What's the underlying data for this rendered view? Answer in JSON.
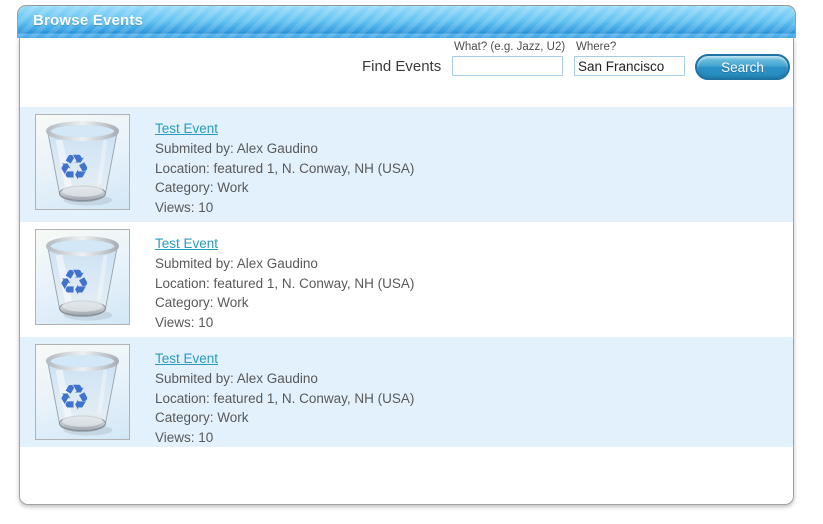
{
  "panel": {
    "title": "Browse Events"
  },
  "search": {
    "find_events_label": "Find Events",
    "what_label": "What? (e.g. Jazz, U2)",
    "what_value": "",
    "where_label": "Where?",
    "where_value": "San Francisco",
    "search_button_label": "Search"
  },
  "events": [
    {
      "title": "Test Event",
      "submitted_by": "Submited by: Alex Gaudino",
      "location": "Location: featured 1, N. Conway, NH (USA)",
      "category": "Category: Work",
      "views": "Views: 10",
      "thumbnail_icon": "recycle-bin-icon"
    },
    {
      "title": "Test Event",
      "submitted_by": "Submited by: Alex Gaudino",
      "location": "Location: featured 1, N. Conway, NH (USA)",
      "category": "Category: Work",
      "views": "Views: 10",
      "thumbnail_icon": "recycle-bin-icon"
    },
    {
      "title": "Test Event",
      "submitted_by": "Submited by: Alex Gaudino",
      "location": "Location: featured 1, N. Conway, NH (USA)",
      "category": "Category: Work",
      "views": "Views: 10",
      "thumbnail_icon": "recycle-bin-icon"
    }
  ],
  "colors": {
    "header_top": "#98dcfa",
    "header_bottom": "#47a8e8",
    "row_alt_bg": "#e2f1fc",
    "link": "#2a9bbd",
    "body_text": "#58595b",
    "button_border": "#1f73a4"
  }
}
